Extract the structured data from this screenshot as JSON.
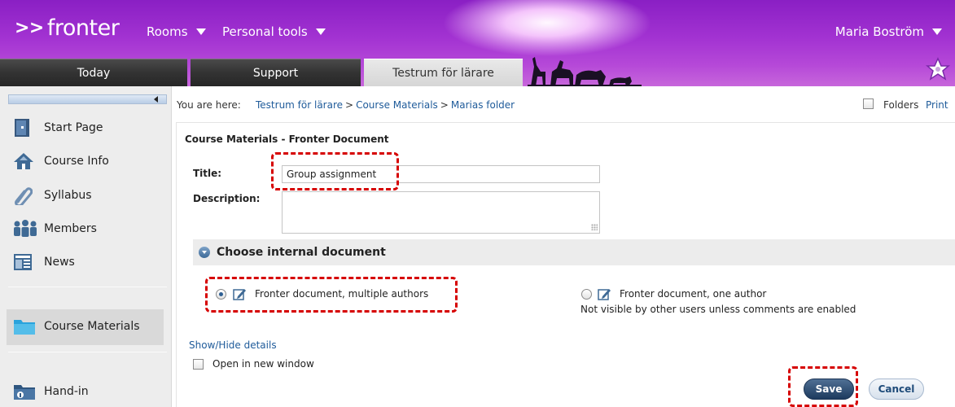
{
  "header": {
    "logo": "fronter",
    "menus": [
      {
        "label": "Rooms"
      },
      {
        "label": "Personal tools"
      }
    ],
    "user": "Maria Boström",
    "tabs": [
      {
        "label": "Today"
      },
      {
        "label": "Support"
      },
      {
        "label": "Testrum för lärare"
      }
    ]
  },
  "sidebar": {
    "items": [
      {
        "label": "Start Page",
        "icon": "door-icon"
      },
      {
        "label": "Course Info",
        "icon": "house-icon"
      },
      {
        "label": "Syllabus",
        "icon": "paperclip-icon"
      },
      {
        "label": "Members",
        "icon": "people-icon"
      },
      {
        "label": "News",
        "icon": "newspaper-icon"
      },
      {
        "label": "Course Materials",
        "icon": "folder-icon"
      },
      {
        "label": "Hand-in",
        "icon": "hand-in-folder-icon"
      }
    ]
  },
  "breadcrumb": {
    "prefix": "You are here:",
    "items": [
      "Testrum för lärare",
      "Course Materials",
      "Marias folder"
    ],
    "separator": ">"
  },
  "toolbar": {
    "folders_label": "Folders",
    "print_label": "Print"
  },
  "form": {
    "page_title": "Course Materials - Fronter Document",
    "title_label": "Title:",
    "title_value": "Group assignment",
    "description_label": "Description:",
    "description_value": "",
    "section_title": "Choose internal document",
    "option_multi": "Fronter document, multiple authors",
    "option_single": "Fronter document, one author",
    "option_single_note": "Not visible by other users unless comments are enabled",
    "selected_option": "multiple authors",
    "show_hide": "Show/Hide details",
    "open_new_window": "Open in new window",
    "save": "Save",
    "cancel": "Cancel"
  },
  "colors": {
    "header_purple": "#a333d2",
    "link_blue": "#1f5b9a",
    "save_navy": "#1d3b5e",
    "highlight_red": "#d60000"
  }
}
